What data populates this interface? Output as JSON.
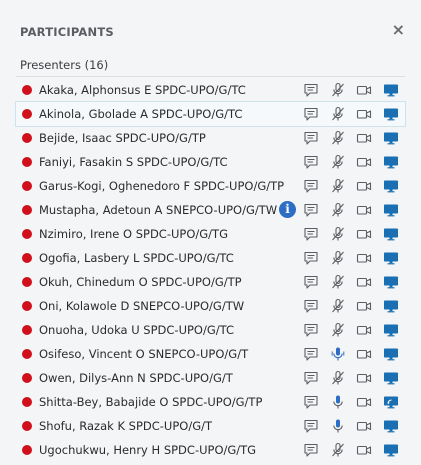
{
  "panel": {
    "title": "PARTICIPANTS",
    "close_glyph": "×"
  },
  "section": {
    "label": "Presenters (16)"
  },
  "colors": {
    "status": "#d0101a",
    "icon_gray": "#5b5d62",
    "mic_blue": "#2d6dc4",
    "screen_blue": "#1a6fb3",
    "info_blue": "#2d6dc4"
  },
  "participants": [
    {
      "name": "Akaka, Alphonsus E SPDC-UPO/G/TC",
      "mic": "muted",
      "screen": "monitor",
      "selected": false,
      "info": false
    },
    {
      "name": "Akinola, Gbolade A SPDC-UPO/G/TC",
      "mic": "muted",
      "screen": "monitor",
      "selected": true,
      "info": false
    },
    {
      "name": "Bejide, Isaac SPDC-UPO/G/TP",
      "mic": "muted",
      "screen": "monitor",
      "selected": false,
      "info": false
    },
    {
      "name": "Faniyi, Fasakin S SPDC-UPO/G/TC",
      "mic": "muted",
      "screen": "monitor",
      "selected": false,
      "info": false
    },
    {
      "name": "Garus-Kogi, Oghenedoro F SPDC-UPO/G/TP",
      "mic": "muted",
      "screen": "monitor",
      "selected": false,
      "info": false
    },
    {
      "name": "Mustapha, Adetoun A SNEPCO-UPO/G/TW",
      "mic": "muted",
      "screen": "monitor",
      "selected": false,
      "info": true
    },
    {
      "name": "Nzimiro, Irene O SPDC-UPO/G/TG",
      "mic": "muted",
      "screen": "monitor",
      "selected": false,
      "info": false
    },
    {
      "name": "Ogofia, Lasbery L SPDC-UPO/G/TC",
      "mic": "muted",
      "screen": "monitor",
      "selected": false,
      "info": false
    },
    {
      "name": "Okuh, Chinedum O SPDC-UPO/G/TP",
      "mic": "muted",
      "screen": "monitor",
      "selected": false,
      "info": false
    },
    {
      "name": "Oni, Kolawole D SNEPCO-UPO/G/TW",
      "mic": "muted",
      "screen": "monitor",
      "selected": false,
      "info": false
    },
    {
      "name": "Onuoha, Udoka U SPDC-UPO/G/TC",
      "mic": "muted",
      "screen": "monitor",
      "selected": false,
      "info": false
    },
    {
      "name": "Osifeso, Vincent O SNEPCO-UPO/G/T",
      "mic": "active",
      "screen": "monitor",
      "selected": false,
      "info": false
    },
    {
      "name": "Owen, Dilys-Ann N SPDC-UPO/G/T",
      "mic": "muted",
      "screen": "monitor",
      "selected": false,
      "info": false
    },
    {
      "name": "Shitta-Bey, Babajide O SPDC-UPO/G/TP",
      "mic": "on",
      "screen": "sharing",
      "selected": false,
      "info": false
    },
    {
      "name": "Shofu, Razak K SPDC-UPO/G/T",
      "mic": "on",
      "screen": "monitor",
      "selected": false,
      "info": false
    },
    {
      "name": "Ugochukwu, Henry H SPDC-UPO/G/TG",
      "mic": "muted",
      "screen": "monitor",
      "selected": false,
      "info": false
    }
  ]
}
